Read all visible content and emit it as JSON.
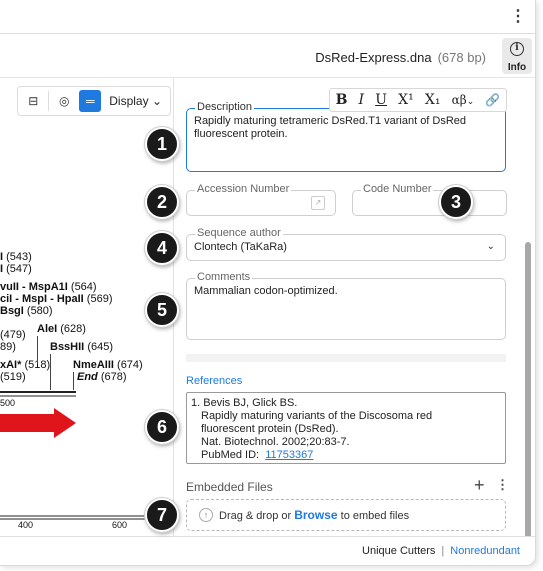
{
  "file": {
    "name": "DsRed-Express.dna",
    "size": "(678 bp)"
  },
  "info_button": {
    "label": "Info"
  },
  "map_toolbar": {
    "display_label": "Display"
  },
  "map": {
    "enzymes": [
      {
        "text": "I",
        "pos": "(543)"
      },
      {
        "text": "I",
        "pos": "(547)"
      },
      {
        "text": "vuII - MspA1I",
        "pos": "(564)"
      },
      {
        "text": "ciI - MspI - HpaII",
        "pos": "(569)"
      },
      {
        "text": "BsgI",
        "pos": "(580)"
      },
      {
        "text": "(479)"
      },
      {
        "text": "AleI",
        "pos": "(628)"
      },
      {
        "text": "89)"
      },
      {
        "text": "BssHII",
        "pos": "(645)"
      },
      {
        "text": "xAI*",
        "pos": "(518)"
      },
      {
        "text": "NmeAIII",
        "pos": "(674)"
      },
      {
        "text": "(519)"
      },
      {
        "text": "End",
        "pos": "(678)"
      }
    ],
    "ruler": [
      "500",
      "400",
      "600"
    ]
  },
  "description": {
    "legend": "Description",
    "text": "Rapidly maturing tetrameric DsRed.T1 variant of DsRed fluorescent protein.",
    "format_buttons": [
      "B",
      "I",
      "U",
      "X¹",
      "X₁",
      "αβ",
      "⌄",
      "🔗"
    ]
  },
  "accession": {
    "legend": "Accession Number",
    "value": ""
  },
  "code": {
    "legend": "Code Number",
    "value": ""
  },
  "author": {
    "legend": "Sequence author",
    "value": "Clontech (TaKaRa)"
  },
  "comments": {
    "legend": "Comments",
    "text": "Mammalian codon-optimized."
  },
  "references": {
    "title": "References",
    "entry": {
      "line1": "1. Bevis BJ, Glick BS.",
      "line2": "Rapidly maturing variants of the Discosoma red",
      "line3": "fluorescent protein (DsRed).",
      "line4": "Nat. Biotechnol. 2002;20:83-7.",
      "pubmed_label": "PubMed ID:",
      "pubmed_id": "11753367"
    }
  },
  "embedded_files": {
    "title": "Embedded Files",
    "drop_text_before": "Drag & drop or",
    "browse": "Browse",
    "drop_text_after": "to embed files"
  },
  "footer": {
    "left": "Unique Cutters",
    "sep": "|",
    "right": "Nonredundant"
  },
  "callouts": [
    "1",
    "2",
    "3",
    "4",
    "5",
    "6",
    "7"
  ],
  "colors": {
    "accent": "#1f7ae0",
    "feature_arrow": "#e0141b",
    "callout": "#1a1a1a"
  }
}
